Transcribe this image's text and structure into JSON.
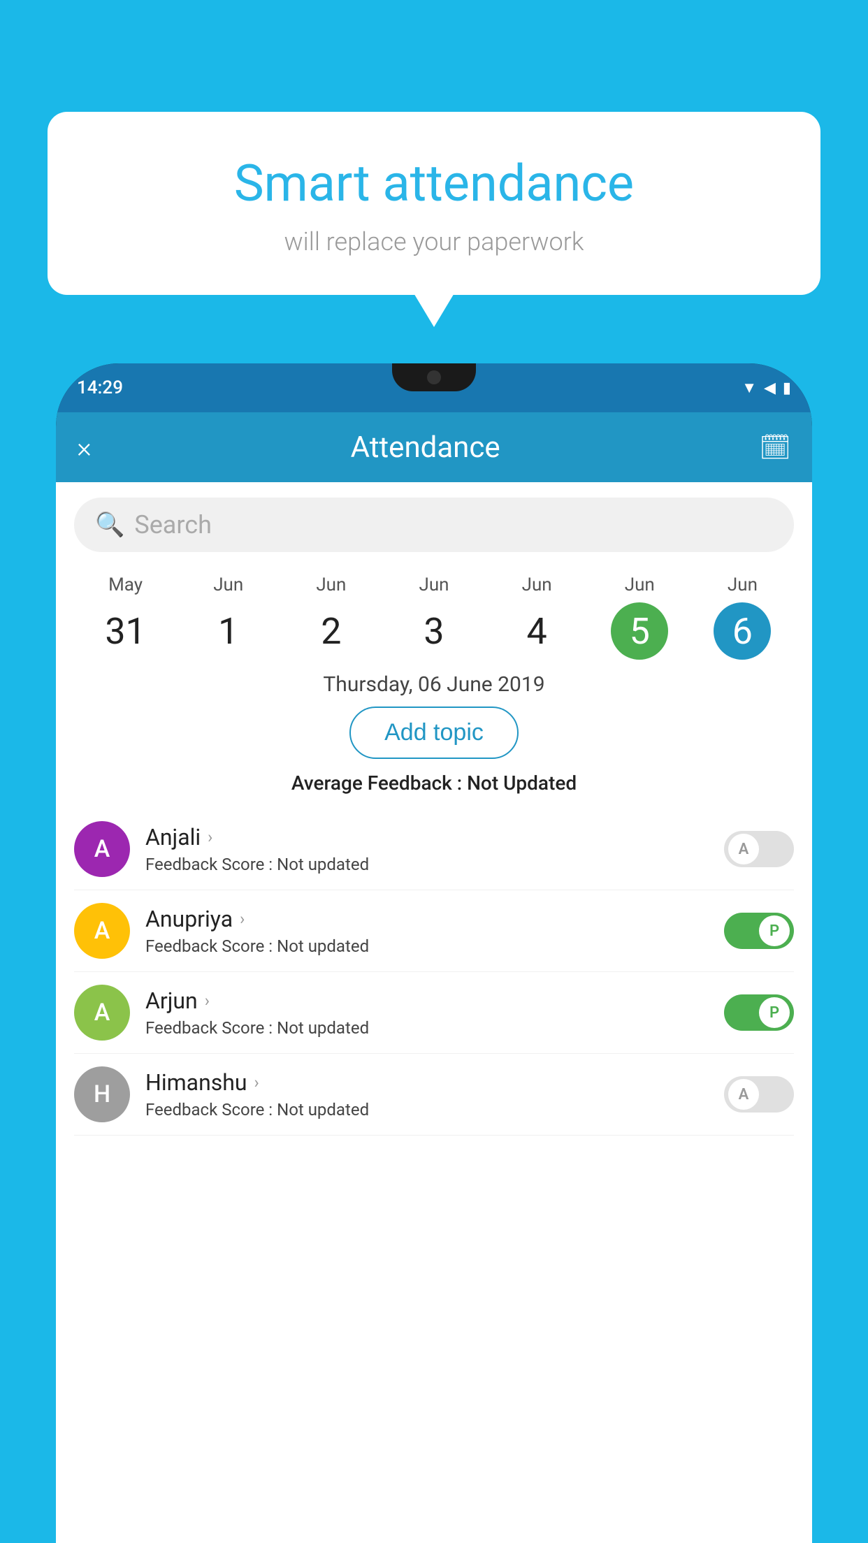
{
  "background_color": "#1bb8e8",
  "bubble": {
    "title": "Smart attendance",
    "subtitle": "will replace your paperwork"
  },
  "status_bar": {
    "time": "14:29",
    "icons": [
      "wifi",
      "signal",
      "battery"
    ]
  },
  "header": {
    "title": "Attendance",
    "close_label": "×",
    "calendar_icon": "📅"
  },
  "search": {
    "placeholder": "Search"
  },
  "dates": [
    {
      "month": "May",
      "day": "31",
      "state": "normal"
    },
    {
      "month": "Jun",
      "day": "1",
      "state": "normal"
    },
    {
      "month": "Jun",
      "day": "2",
      "state": "normal"
    },
    {
      "month": "Jun",
      "day": "3",
      "state": "normal"
    },
    {
      "month": "Jun",
      "day": "4",
      "state": "normal"
    },
    {
      "month": "Jun",
      "day": "5",
      "state": "green"
    },
    {
      "month": "Jun",
      "day": "6",
      "state": "blue"
    }
  ],
  "selected_date": "Thursday, 06 June 2019",
  "add_topic_label": "Add topic",
  "avg_feedback": {
    "label": "Average Feedback : ",
    "value": "Not Updated"
  },
  "students": [
    {
      "name": "Anjali",
      "avatar_letter": "A",
      "avatar_color": "#9c27b0",
      "feedback": "Feedback Score : ",
      "feedback_value": "Not updated",
      "toggle_state": "off",
      "toggle_label": "A"
    },
    {
      "name": "Anupriya",
      "avatar_letter": "A",
      "avatar_color": "#ffc107",
      "feedback": "Feedback Score : ",
      "feedback_value": "Not updated",
      "toggle_state": "on",
      "toggle_label": "P"
    },
    {
      "name": "Arjun",
      "avatar_letter": "A",
      "avatar_color": "#8bc34a",
      "feedback": "Feedback Score : ",
      "feedback_value": "Not updated",
      "toggle_state": "on",
      "toggle_label": "P"
    },
    {
      "name": "Himanshu",
      "avatar_letter": "H",
      "avatar_color": "#9e9e9e",
      "feedback": "Feedback Score : ",
      "feedback_value": "Not updated",
      "toggle_state": "off",
      "toggle_label": "A"
    }
  ]
}
